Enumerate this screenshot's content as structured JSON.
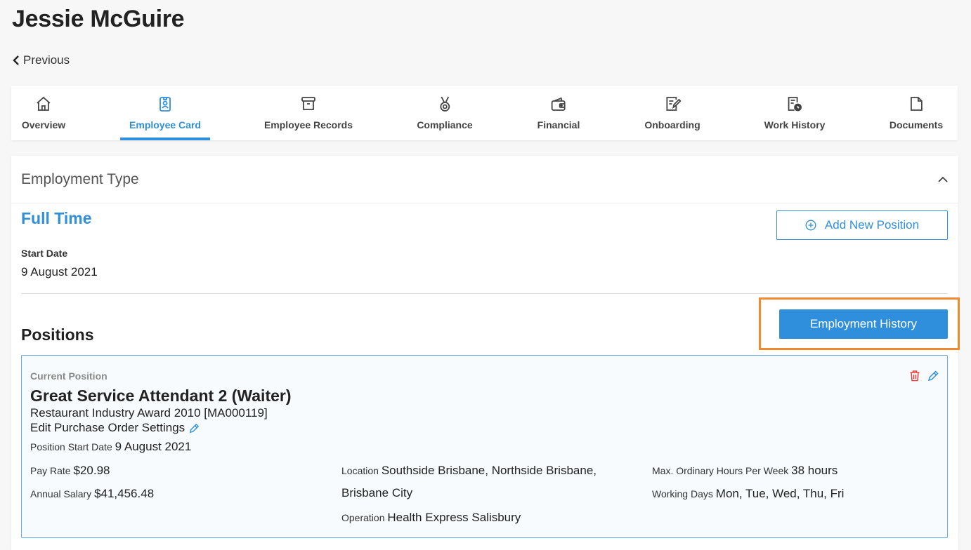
{
  "page": {
    "title": "Jessie McGuire",
    "previous_label": "Previous"
  },
  "tabs": [
    {
      "label": "Overview",
      "icon": "home-icon"
    },
    {
      "label": "Employee Card",
      "icon": "id-badge-icon",
      "active": true
    },
    {
      "label": "Employee Records",
      "icon": "archive-box-icon"
    },
    {
      "label": "Compliance",
      "icon": "medal-icon"
    },
    {
      "label": "Financial",
      "icon": "wallet-icon"
    },
    {
      "label": "Onboarding",
      "icon": "edit-note-icon"
    },
    {
      "label": "Work History",
      "icon": "document-clock-icon"
    },
    {
      "label": "Documents",
      "icon": "file-icon"
    }
  ],
  "employment": {
    "section_title": "Employment Type",
    "type": "Full Time",
    "add_position_label": "Add New Position",
    "start_date_label": "Start Date",
    "start_date_value": "9 August 2021"
  },
  "positions": {
    "title": "Positions",
    "history_button_label": "Employment History",
    "current": {
      "label": "Current Position",
      "title": "Great Service Attendant 2 (Waiter)",
      "award": "Restaurant Industry Award 2010 [MA000119]",
      "edit_po_label": "Edit Purchase Order Settings",
      "position_start_label": "Position Start Date",
      "position_start_value": "9 August 2021",
      "pay_rate_label": "Pay Rate",
      "pay_rate_value": "$20.98",
      "annual_salary_label": "Annual Salary",
      "annual_salary_value": "$41,456.48",
      "location_label": "Location",
      "location_value_line1": "Southside Brisbane, Northside Brisbane,",
      "location_value_line2": "Brisbane City",
      "operation_label": "Operation",
      "operation_value": "Health Express Salisbury",
      "max_hours_label": "Max. Ordinary Hours Per Week",
      "max_hours_value": "38 hours",
      "working_days_label": "Working Days",
      "working_days_value": "Mon, Tue, Wed, Thu, Fri"
    }
  },
  "colors": {
    "accent": "#2f8fdc",
    "highlight": "#ef8a33",
    "delete": "#e53935"
  }
}
